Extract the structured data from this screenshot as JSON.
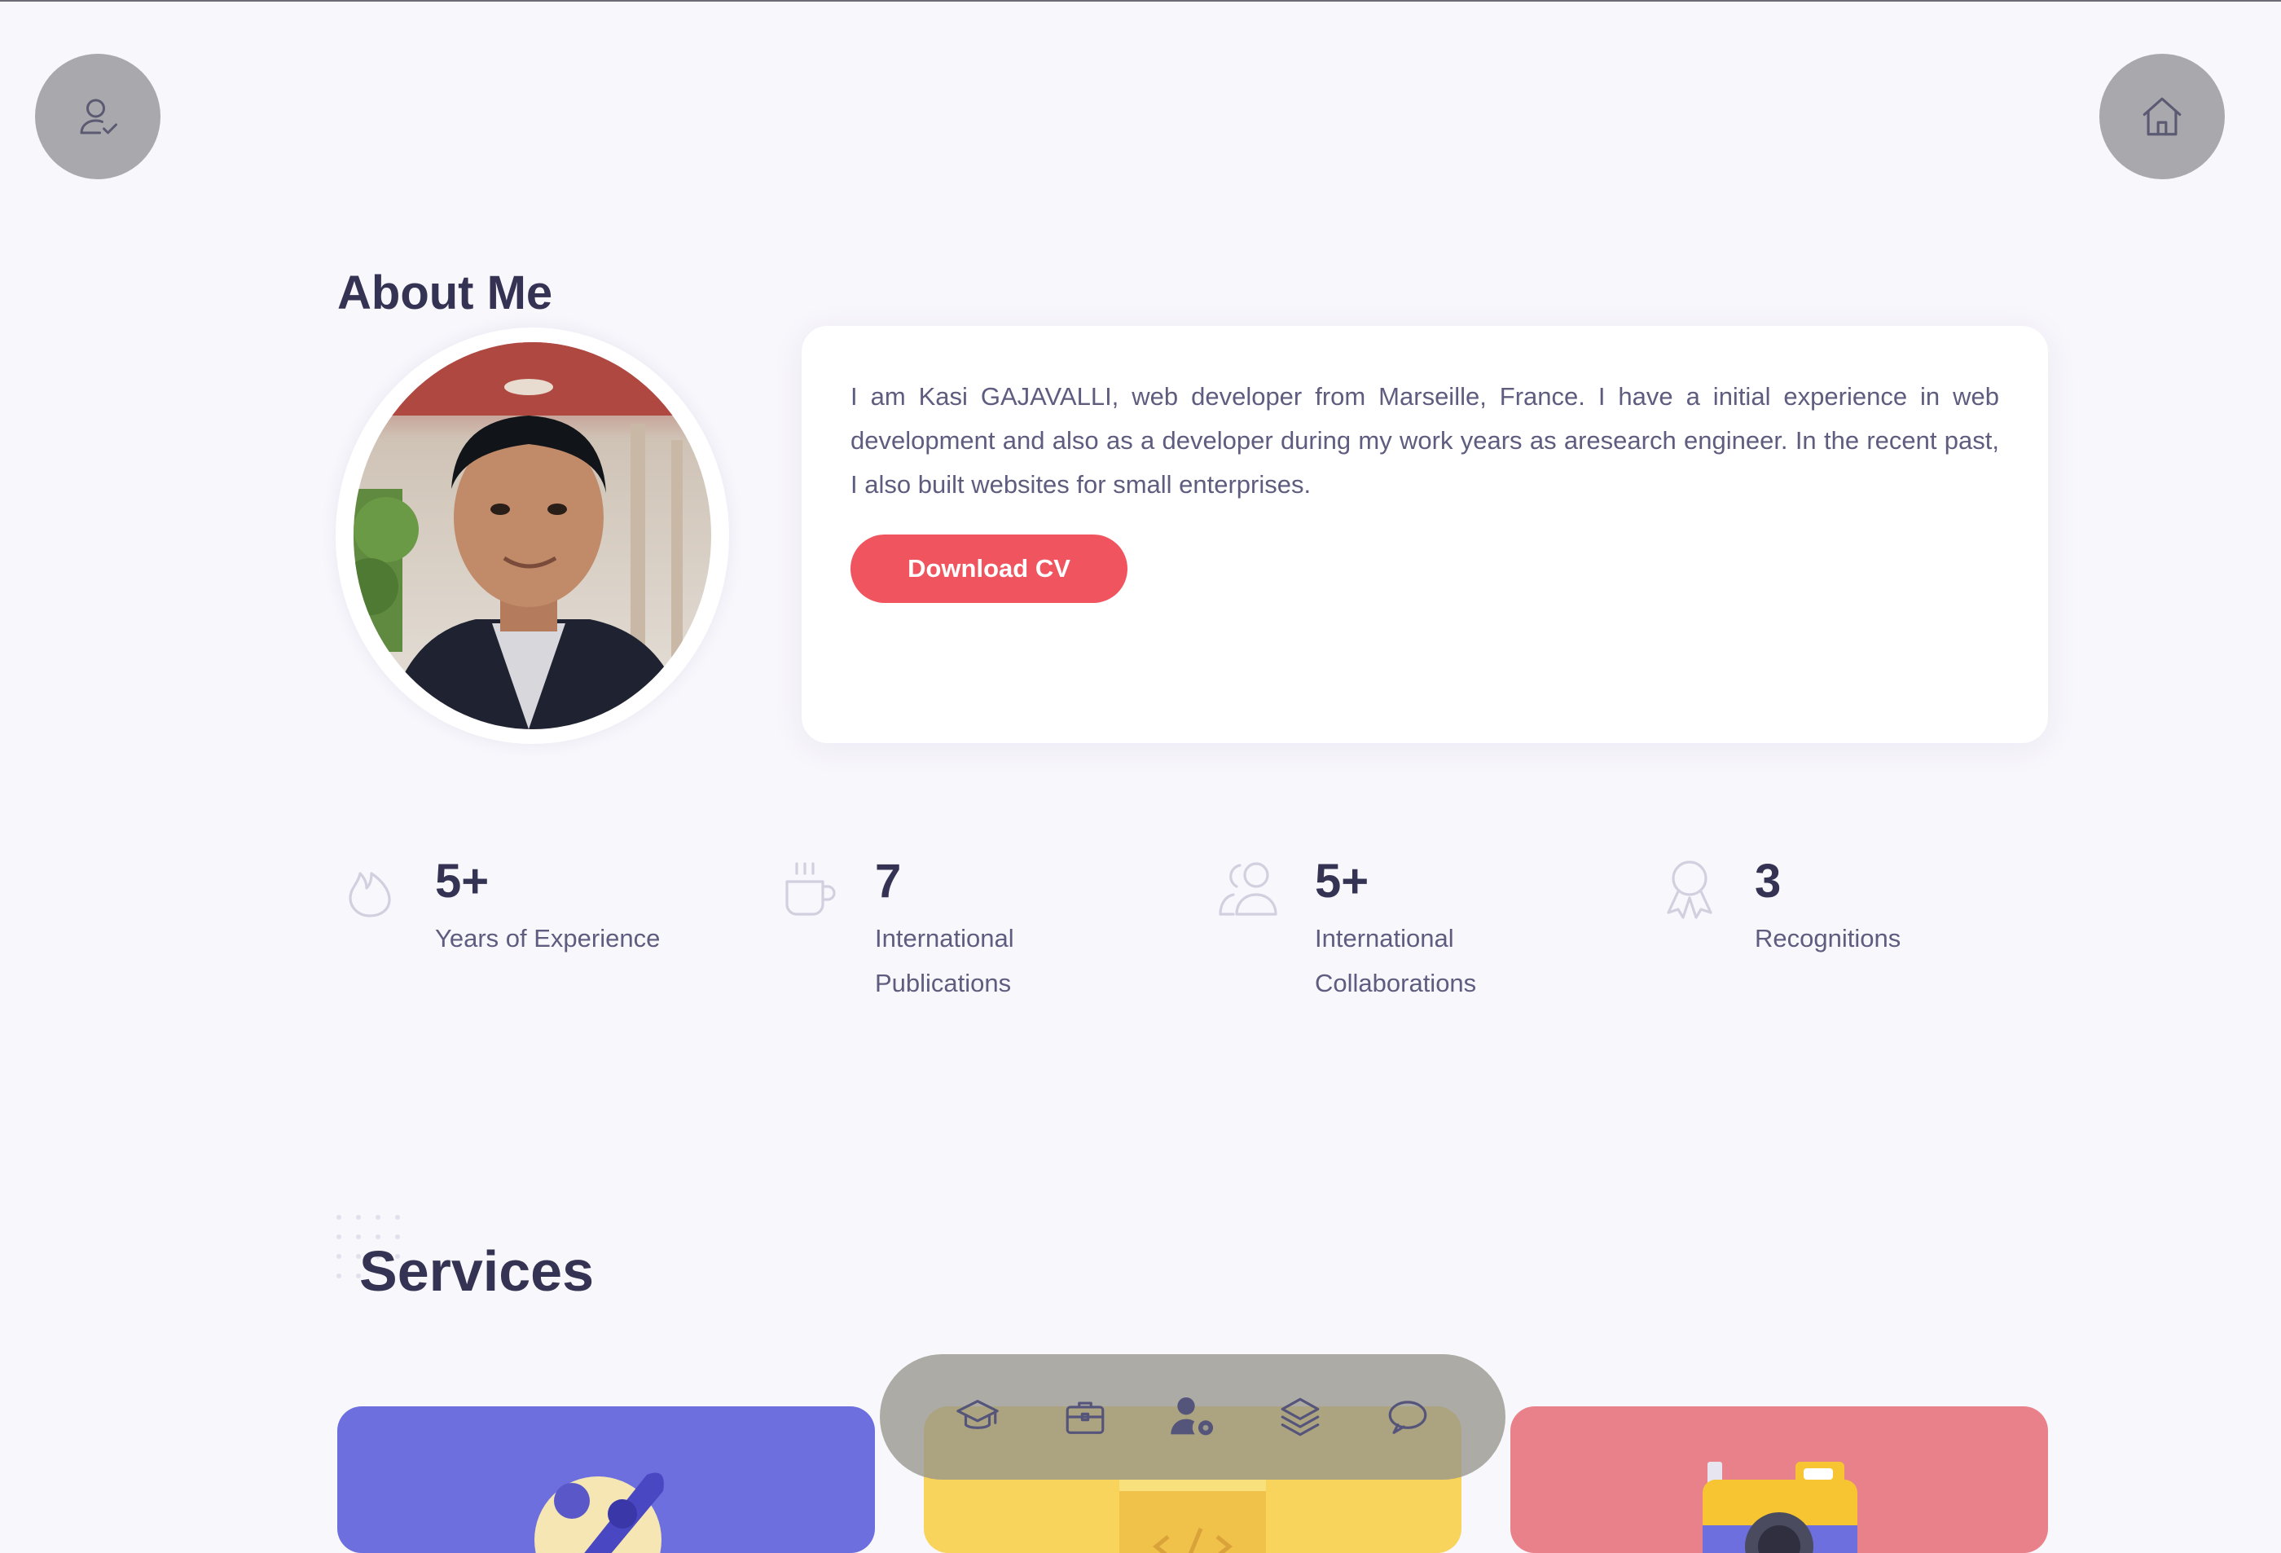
{
  "header": {
    "left_button_icon": "user-check-icon",
    "right_button_icon": "home-icon"
  },
  "about": {
    "title": "About Me",
    "bio": "I am Kasi GAJAVALLI, web developer from Marseille, France. I have a initial experience in web development and also as a developer during my work years as aresearch engineer. In the recent past, I also built websites for small enterprises.",
    "cv_button": "Download CV"
  },
  "stats": [
    {
      "icon": "fire-icon",
      "number": "5+",
      "label": "Years of Experience"
    },
    {
      "icon": "coffee-cup-icon",
      "number": "7",
      "label": "International Publications"
    },
    {
      "icon": "users-icon",
      "number": "5+",
      "label": "International Collaborations"
    },
    {
      "icon": "award-icon",
      "number": "3",
      "label": "Recognitions"
    }
  ],
  "services": {
    "title": "Services",
    "cards": [
      {
        "icon": "rocket-icon",
        "color": "#6c6fdd"
      },
      {
        "icon": "code-icon",
        "color": "#f8d45c"
      },
      {
        "icon": "camera-icon",
        "color": "#e9818a"
      }
    ]
  },
  "bottom_nav": [
    {
      "icon": "graduation-cap-icon"
    },
    {
      "icon": "briefcase-icon"
    },
    {
      "icon": "user-gear-icon"
    },
    {
      "icon": "layers-icon"
    },
    {
      "icon": "chat-bubble-icon"
    }
  ],
  "colors": {
    "background": "#f8f7fc",
    "primary_text": "#353353",
    "body_text": "#5e5c7f",
    "accent": "#f0555f"
  }
}
